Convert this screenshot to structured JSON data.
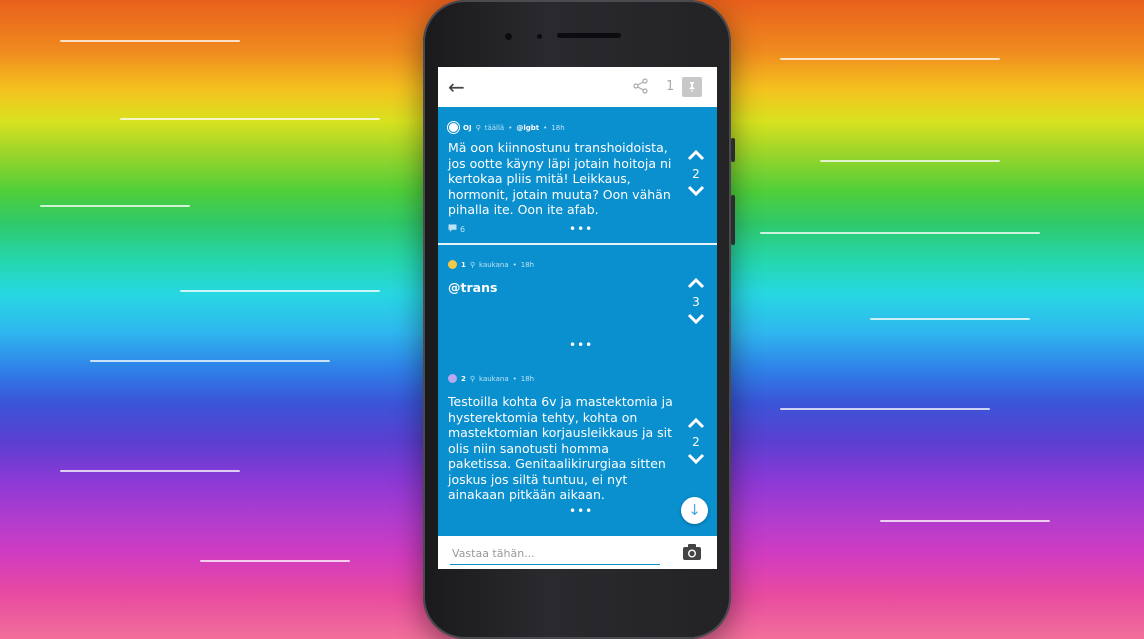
{
  "header": {
    "back_icon": "←",
    "pin_count": "1",
    "pin_icon": "📌"
  },
  "posts": [
    {
      "author": "OJ",
      "location": "täällä",
      "channel": "@lgbt",
      "time": "18h",
      "text": "Mä oon kiinnostunu transhoidoista, jos ootte käyny läpi jotain hoitoja ni kertokaa pliis mitä! Leikkaus, hormonit, jotain muuta? Oon vähän pihalla ite. Oon ite afab.",
      "votes": "2",
      "comments": "6",
      "avatar_color": "#ffffff"
    },
    {
      "author": "1",
      "location": "kaukana",
      "channel": "",
      "time": "18h",
      "text": "@trans",
      "votes": "3",
      "avatar_color": "#f5c84a"
    },
    {
      "author": "2",
      "location": "kaukana",
      "channel": "",
      "time": "18h",
      "text": "Testoilla kohta 6v ja mastektomia ja hysterektomia tehty, kohta on mastektomian korjausleikkaus ja sit olis niin sanotusti homma paketissa. Genitaalikirurgiaa sitten joskus jos siltä tuntuu, ei nyt ainakaan pitkään aikaan.",
      "votes": "2",
      "avatar_color": "#b8a9f0"
    }
  ],
  "reply": {
    "placeholder": "Vastaa tähän..."
  },
  "icons": {
    "up": "⌃",
    "down": "⌄",
    "more": "•••",
    "scroll_down": "↓"
  }
}
